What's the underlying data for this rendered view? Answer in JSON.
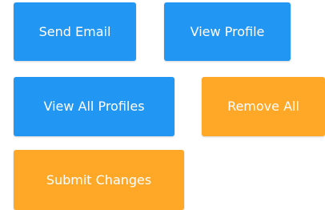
{
  "buttons": {
    "send_email": "Send Email",
    "view_profile": "View Profile",
    "view_all_profiles": "View All Profiles",
    "remove_all": "Remove All",
    "submit_changes": "Submit Changes"
  },
  "colors": {
    "primary_blue": "#2196f3",
    "warning_orange": "#ffa726",
    "text": "#ffffff",
    "background": "#ffffff"
  }
}
